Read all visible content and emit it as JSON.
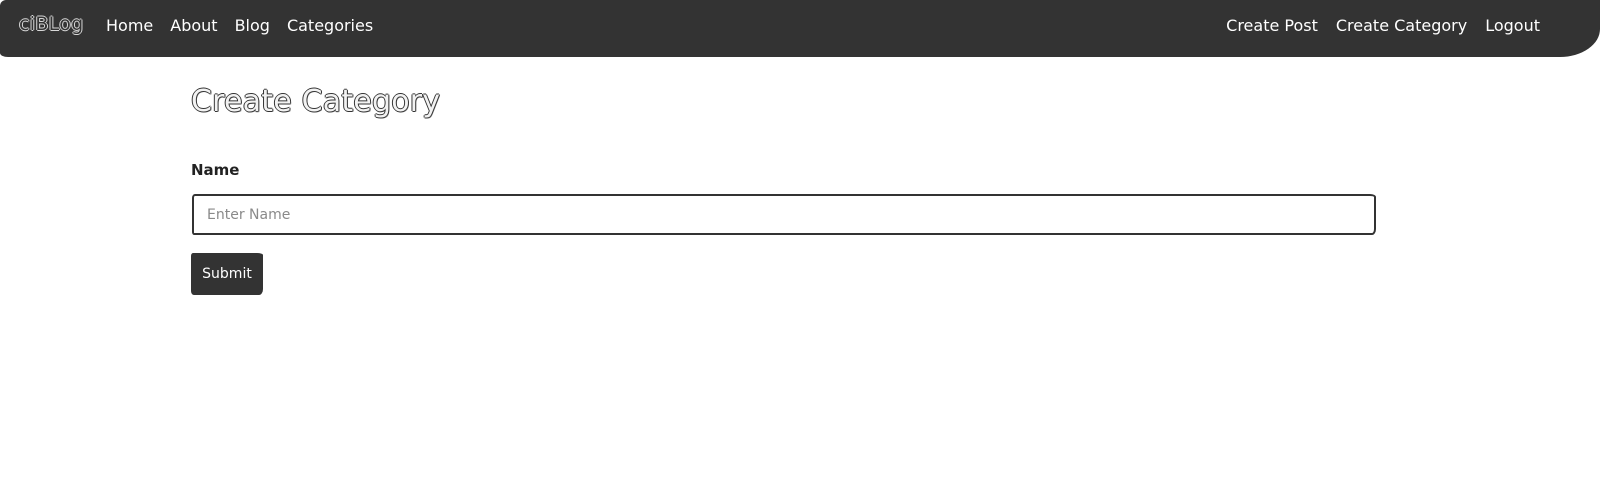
{
  "navbar": {
    "brand": "ciBLog",
    "left_links": [
      {
        "label": "Home"
      },
      {
        "label": "About"
      },
      {
        "label": "Blog"
      },
      {
        "label": "Categories"
      }
    ],
    "right_links": [
      {
        "label": "Create Post"
      },
      {
        "label": "Create Category"
      },
      {
        "label": "Logout"
      }
    ]
  },
  "page": {
    "title": "Create Category"
  },
  "form": {
    "name_label": "Name",
    "name_value": "",
    "name_placeholder": "Enter Name",
    "submit_label": "Submit"
  },
  "colors": {
    "navbar_bg": "#333333",
    "button_bg": "#333333",
    "nav_text": "#ffffff"
  }
}
